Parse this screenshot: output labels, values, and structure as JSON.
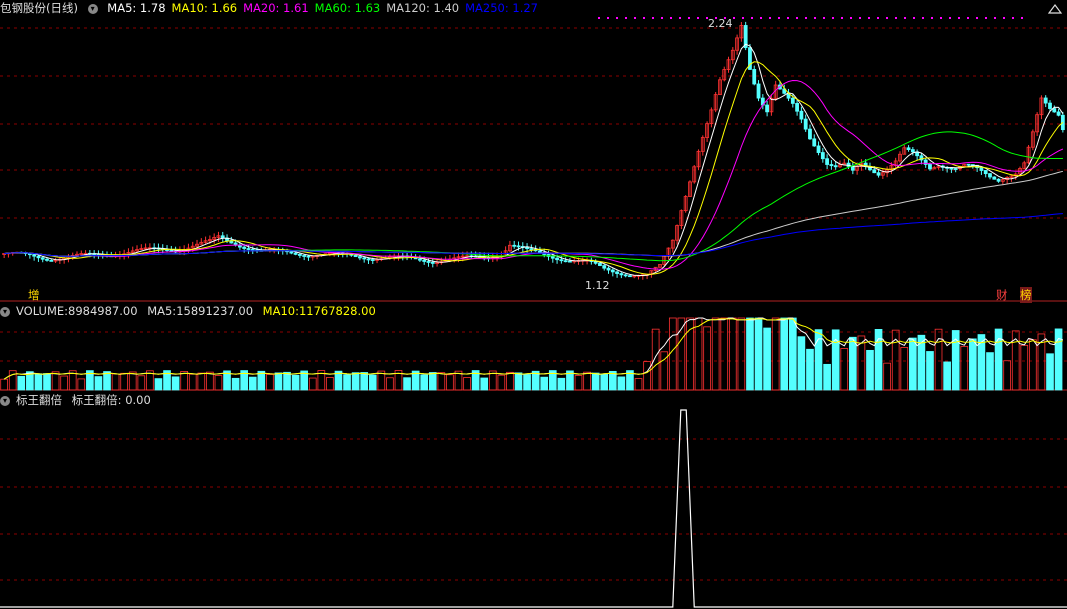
{
  "main_panel": {
    "stock_name": "包钢股份",
    "period": "(日线)",
    "ma": [
      {
        "label": "MA5:",
        "value": "1.78",
        "color": "#ffffff"
      },
      {
        "label": "MA10:",
        "value": "1.66",
        "color": "#ffff00"
      },
      {
        "label": "MA20:",
        "value": "1.61",
        "color": "#ff00ff"
      },
      {
        "label": "MA60:",
        "value": "1.63",
        "color": "#00ff00"
      },
      {
        "label": "MA120:",
        "value": "1.40",
        "color": "#cccccc"
      },
      {
        "label": "MA250:",
        "value": "1.27",
        "color": "#0000ff"
      }
    ],
    "high_label": "2.24",
    "low_label": "1.12",
    "tag_zeng": "增",
    "tag_cai": "财",
    "tag_bang": "榜"
  },
  "volume_panel": {
    "title": "VOLUME:",
    "value": "8984987.00",
    "ma5_label": "MA5:",
    "ma5_value": "15891237.00",
    "ma10_label": "MA10:",
    "ma10_value": "11767828.00"
  },
  "indicator_panel": {
    "title": "标王翻倍",
    "series_label": "标王翻倍:",
    "value": "0.00"
  },
  "colors": {
    "up": "#ff3232",
    "down": "#54ffff",
    "grid": "#8b0000",
    "separator": "#b22222"
  },
  "chart_data": [
    {
      "type": "candlestick",
      "title": "包钢股份 (日线)",
      "y_range": [
        1.12,
        2.24
      ],
      "extremes": {
        "high": 2.24,
        "low": 1.12
      },
      "last_ma": {
        "MA5": 1.78,
        "MA10": 1.66,
        "MA20": 1.61,
        "MA60": 1.63,
        "MA120": 1.4,
        "MA250": 1.27
      },
      "price_path": [
        [
          0,
          1.22
        ],
        [
          10,
          1.2
        ],
        [
          20,
          1.21
        ],
        [
          30,
          1.23
        ],
        [
          40,
          1.24
        ],
        [
          48,
          1.27
        ],
        [
          50,
          1.29
        ],
        [
          55,
          1.26
        ],
        [
          60,
          1.23
        ],
        [
          70,
          1.22
        ],
        [
          80,
          1.21
        ],
        [
          90,
          1.2
        ],
        [
          100,
          1.19
        ],
        [
          110,
          1.2
        ],
        [
          116,
          1.22
        ],
        [
          118,
          1.26
        ],
        [
          122,
          1.23
        ],
        [
          130,
          1.2
        ],
        [
          136,
          1.18
        ],
        [
          140,
          1.15
        ],
        [
          146,
          1.13
        ],
        [
          150,
          1.12
        ],
        [
          153,
          1.16
        ],
        [
          156,
          1.28
        ],
        [
          158,
          1.42
        ],
        [
          160,
          1.55
        ],
        [
          162,
          1.68
        ],
        [
          165,
          1.85
        ],
        [
          167,
          1.98
        ],
        [
          170,
          2.12
        ],
        [
          172,
          2.24
        ],
        [
          174,
          2.05
        ],
        [
          176,
          1.92
        ],
        [
          178,
          1.85
        ],
        [
          180,
          1.96
        ],
        [
          182,
          1.92
        ],
        [
          184,
          1.88
        ],
        [
          186,
          1.82
        ],
        [
          188,
          1.74
        ],
        [
          190,
          1.68
        ],
        [
          192,
          1.62
        ],
        [
          194,
          1.6
        ],
        [
          196,
          1.61
        ],
        [
          198,
          1.58
        ],
        [
          200,
          1.62
        ],
        [
          202,
          1.6
        ],
        [
          204,
          1.58
        ],
        [
          206,
          1.6
        ],
        [
          208,
          1.63
        ],
        [
          210,
          1.68
        ],
        [
          212,
          1.66
        ],
        [
          214,
          1.63
        ],
        [
          216,
          1.6
        ],
        [
          218,
          1.62
        ],
        [
          220,
          1.61
        ],
        [
          222,
          1.6
        ],
        [
          224,
          1.61
        ],
        [
          226,
          1.6
        ],
        [
          228,
          1.58
        ],
        [
          230,
          1.56
        ],
        [
          232,
          1.55
        ],
        [
          234,
          1.57
        ],
        [
          236,
          1.58
        ],
        [
          238,
          1.62
        ],
        [
          240,
          1.75
        ],
        [
          242,
          1.9
        ],
        [
          244,
          1.86
        ],
        [
          246,
          1.84
        ],
        [
          247,
          1.78
        ]
      ]
    },
    {
      "type": "bar",
      "title": "VOLUME",
      "last": {
        "VOLUME": 8984987.0,
        "MA5": 15891237.0,
        "MA10": 11767828.0
      }
    },
    {
      "type": "line",
      "title": "标王翻倍",
      "last_value": 0.0,
      "pulse": {
        "start_bar": 156,
        "end_bar": 161,
        "value": 1
      }
    }
  ]
}
